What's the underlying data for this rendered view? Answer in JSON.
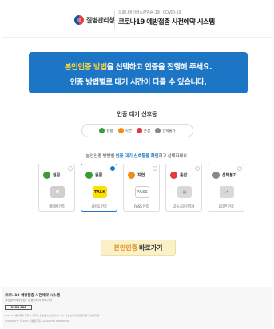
{
  "header": {
    "logo_text": "질병관리청",
    "subtitle": "코로나바이러스감염증-19 | COVID-19",
    "title": "코로나19 예방접종 사전예약 시스템"
  },
  "banner": {
    "line1_highlight": "본인인증 방법",
    "line1_rest": "을 선택하고 인증을 진행해 주세요.",
    "line2": "인증 방법별로 대기 시간이 다를 수 있습니다."
  },
  "signal": {
    "title": "인증 대기 신호등",
    "legend": [
      {
        "label": "원활",
        "color": "#3a9b3a"
      },
      {
        "label": "지연",
        "color": "#f08c18"
      },
      {
        "label": "혼잡",
        "color": "#e0393e"
      },
      {
        "label": "선택불가",
        "color": "#888888"
      }
    ]
  },
  "guide": {
    "prefix": "본인인증 방법별",
    "highlight": "인증 대기 신호등을 확인",
    "suffix": "하고 선택하세요."
  },
  "methods": [
    {
      "status": "원활",
      "status_color": "#3a9b3a",
      "logo_text": "N",
      "logo_bg": "#cfcfcf",
      "logo_fg": "#ffffff",
      "caption": "네이버 인증",
      "selected": false
    },
    {
      "status": "원활",
      "status_color": "#3a9b3a",
      "logo_text": "TALK",
      "logo_bg": "#fae100",
      "logo_fg": "#3c1e1e",
      "caption": "카카오 인증",
      "selected": true
    },
    {
      "status": "지연",
      "status_color": "#f08c18",
      "logo_text": "PASS",
      "logo_bg": "#ffffff",
      "logo_fg": "#9a9a9a",
      "caption": "PASS 인증",
      "selected": false
    },
    {
      "status": "혼잡",
      "status_color": "#e0393e",
      "logo_text": "▤",
      "logo_bg": "#d9d9d9",
      "logo_fg": "#777777",
      "caption": "공동·금융인증서",
      "selected": false
    },
    {
      "status": "선택불가",
      "status_color": "#888888",
      "logo_text": "↗",
      "logo_bg": "#d9d9d9",
      "logo_fg": "#777777",
      "caption": "휴대폰 인증",
      "selected": false
    }
  ],
  "go_button": {
    "highlight": "본인인증",
    "rest": "바로가기"
  },
  "footer": {
    "title": "코로나19 예방접종 사전예약 시스템",
    "links": "개인정보처리방침 · 접종관리자 바로가기",
    "badge": "OPEN 888",
    "address": "(28159) 충청북도 청주시 흥덕구 오송읍 오송생명2로 187 오송보건의료행정타운 질병관리청",
    "copyright": "COPYRIGHT © 2021 질병관리청 ALL RIGHTS RESERVED."
  }
}
